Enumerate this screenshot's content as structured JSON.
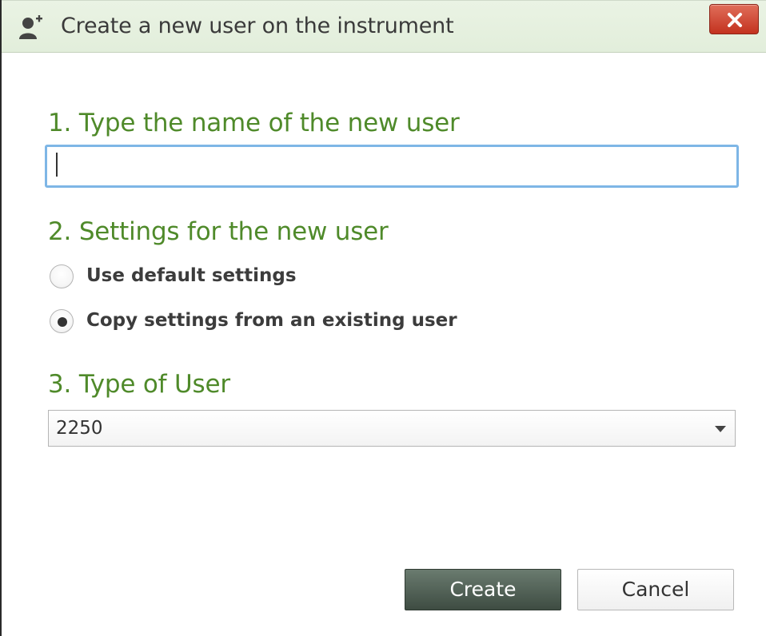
{
  "window": {
    "title": "Create a new user on the instrument",
    "title_icon": "add-user-icon",
    "close_label": "X"
  },
  "sections": {
    "name": {
      "heading": "1. Type the name of the new user",
      "input_value": ""
    },
    "settings": {
      "heading": "2. Settings for the new user",
      "options": [
        {
          "label": "Use default settings",
          "selected": false
        },
        {
          "label": "Copy settings from an existing user",
          "selected": true
        }
      ]
    },
    "type": {
      "heading": "3. Type of User",
      "selected_value": "2250"
    }
  },
  "buttons": {
    "create_label": "Create",
    "cancel_label": "Cancel"
  },
  "colors": {
    "heading_green": "#4f8a2a",
    "titlebar_bg": "#e6f0df",
    "close_red": "#c3321f",
    "focus_blue": "#7eb6e6",
    "create_button": "#4e5d52"
  }
}
